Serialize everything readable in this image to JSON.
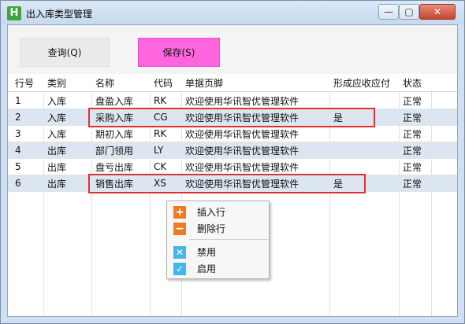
{
  "window": {
    "icon_letter": "H",
    "title": "出入库类型管理",
    "min_glyph": "—",
    "max_glyph": "▢",
    "close_glyph": "✕"
  },
  "toolbar": {
    "query_label": "查询(Q)",
    "save_label": "保存(S)",
    "save_color": "#ff66dd"
  },
  "table": {
    "columns": [
      "行号",
      "类别",
      "名称",
      "代码",
      "单据页脚",
      "形成应收应付",
      "状态"
    ],
    "rows": [
      {
        "no": "1",
        "type": "入库",
        "name": "盘盈入库",
        "code": "RK",
        "footer": "欢迎使用华讯智优管理软件",
        "ar_ap": "",
        "status": "正常"
      },
      {
        "no": "2",
        "type": "入库",
        "name": "采购入库",
        "code": "CG",
        "footer": "欢迎使用华讯智优管理软件",
        "ar_ap": "是",
        "status": "正常"
      },
      {
        "no": "3",
        "type": "入库",
        "name": "期初入库",
        "code": "RK",
        "footer": "欢迎使用华讯智优管理软件",
        "ar_ap": "",
        "status": "正常"
      },
      {
        "no": "4",
        "type": "出库",
        "name": "部门领用",
        "code": "LY",
        "footer": "欢迎使用华讯智优管理软件",
        "ar_ap": "",
        "status": "正常"
      },
      {
        "no": "5",
        "type": "出库",
        "name": "盘亏出库",
        "code": "CK",
        "footer": "欢迎使用华讯智优管理软件",
        "ar_ap": "",
        "status": "正常"
      },
      {
        "no": "6",
        "type": "出库",
        "name": "销售出库",
        "code": "XS",
        "footer": "欢迎使用华讯智优管理软件",
        "ar_ap": "是",
        "status": "正常"
      }
    ],
    "highlight_color": "#e03030",
    "alt_row_color": "#dce6f1"
  },
  "context_menu": {
    "items": [
      {
        "icon": "plus-icon",
        "glyph": "+",
        "label": "插入行"
      },
      {
        "icon": "minus-icon",
        "glyph": "−",
        "label": "删除行"
      },
      {
        "icon": "disable-x-icon",
        "glyph": "✕",
        "label": "禁用"
      },
      {
        "icon": "enable-check-icon",
        "glyph": "✓",
        "label": "启用"
      }
    ]
  }
}
